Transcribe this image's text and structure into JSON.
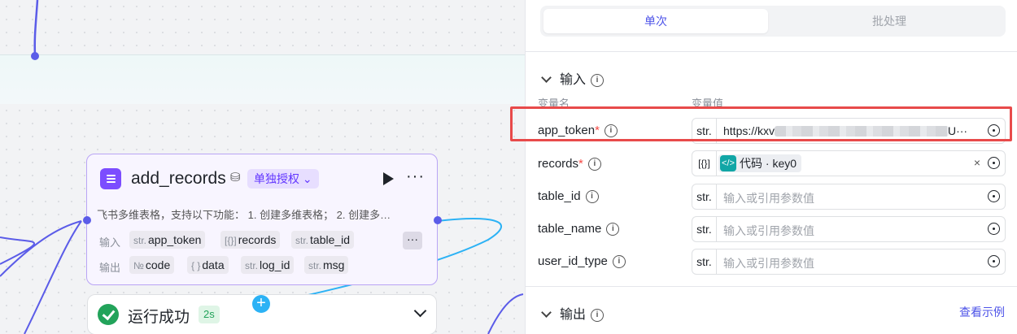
{
  "canvas": {
    "node": {
      "title": "add_records",
      "auth_label": "单独授权",
      "description": "飞书多维表格，支持以下功能： 1. 创建多维表格； 2. 创建多…",
      "inputs_label": "输入",
      "outputs_label": "输出",
      "inputs": [
        {
          "type": "str.",
          "name": "app_token"
        },
        {
          "type": "[{}]",
          "name": "records"
        },
        {
          "type": "str.",
          "name": "table_id"
        }
      ],
      "outputs": [
        {
          "type": "№",
          "name": "code"
        },
        {
          "type": "{ }",
          "name": "data"
        },
        {
          "type": "str.",
          "name": "log_id"
        },
        {
          "type": "str.",
          "name": "msg"
        }
      ],
      "more_label": "···"
    },
    "run": {
      "status": "运行成功",
      "duration": "2s"
    }
  },
  "panel": {
    "tabs": {
      "single": "单次",
      "batch": "批处理"
    },
    "input_section": "输入",
    "col_name": "变量名",
    "col_value": "变量值",
    "params": [
      {
        "label": "app_token",
        "required": true,
        "type": "str.",
        "value_start": "https://kxv",
        "value_end": "U···"
      },
      {
        "label": "records",
        "required": true,
        "type": "[{}]",
        "ref_source": "代码",
        "ref_key": "key0"
      },
      {
        "label": "table_id",
        "required": false,
        "type": "str.",
        "placeholder": "输入或引用参数值"
      },
      {
        "label": "table_name",
        "required": false,
        "type": "str.",
        "placeholder": "输入或引用参数值"
      },
      {
        "label": "user_id_type",
        "required": false,
        "type": "str.",
        "placeholder": "输入或引用参数值"
      }
    ],
    "output_section": "输出",
    "view_example": "查看示例"
  },
  "colors": {
    "accent": "#4d53e8",
    "node_border": "#b9a4f5",
    "success": "#22a35a",
    "highlight": "#e84a4a"
  }
}
